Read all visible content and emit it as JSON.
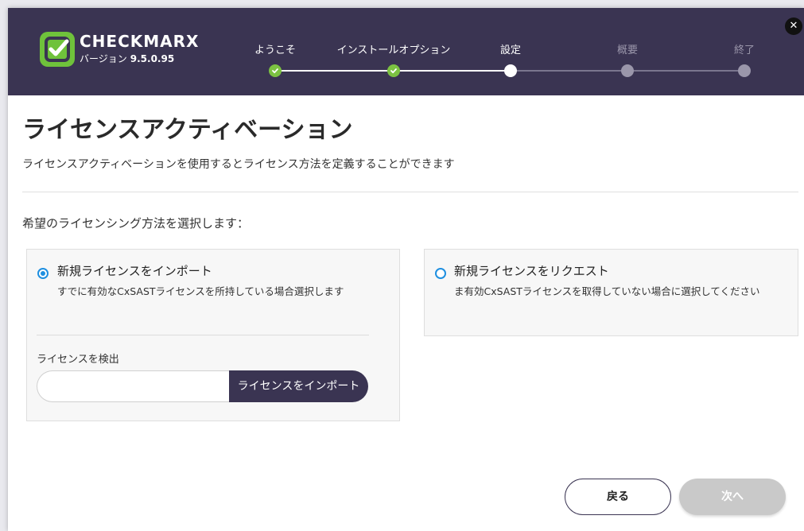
{
  "header": {
    "brand": "CHECKMARX",
    "version_label": "バージョン",
    "version": "9.5.0.95",
    "close_glyph": "✕"
  },
  "steps": [
    {
      "label": "ようこそ",
      "state": "done"
    },
    {
      "label": "インストールオプション",
      "state": "done"
    },
    {
      "label": "設定",
      "state": "current"
    },
    {
      "label": "概要",
      "state": "future"
    },
    {
      "label": "終了",
      "state": "future"
    }
  ],
  "main": {
    "title": "ライセンスアクティベーション",
    "subtitle": "ライセンスアクティベーションを使用するとライセンス方法を定義することができます",
    "prompt": "希望のライセンシング方法を選択します："
  },
  "options": {
    "import": {
      "title": "新規ライセンスをインポート",
      "description": "すでに有効なCxSASTライセンスを所持している場合選択します",
      "selected": true,
      "field_label": "ライセンスを検出",
      "input_value": "",
      "button_label": "ライセンスをインポート"
    },
    "request": {
      "title": "新規ライセンスをリクエスト",
      "description": "ま有効CxSASTライセンスを取得していない場合に選択してください",
      "selected": false
    }
  },
  "footer": {
    "back_label": "戻る",
    "next_label": "次へ",
    "next_enabled": false
  },
  "colors": {
    "header_bg": "#3a3452",
    "accent_green": "#7cc242",
    "radio_blue": "#1e8fe0",
    "disabled_gray": "#c9c9c9"
  }
}
